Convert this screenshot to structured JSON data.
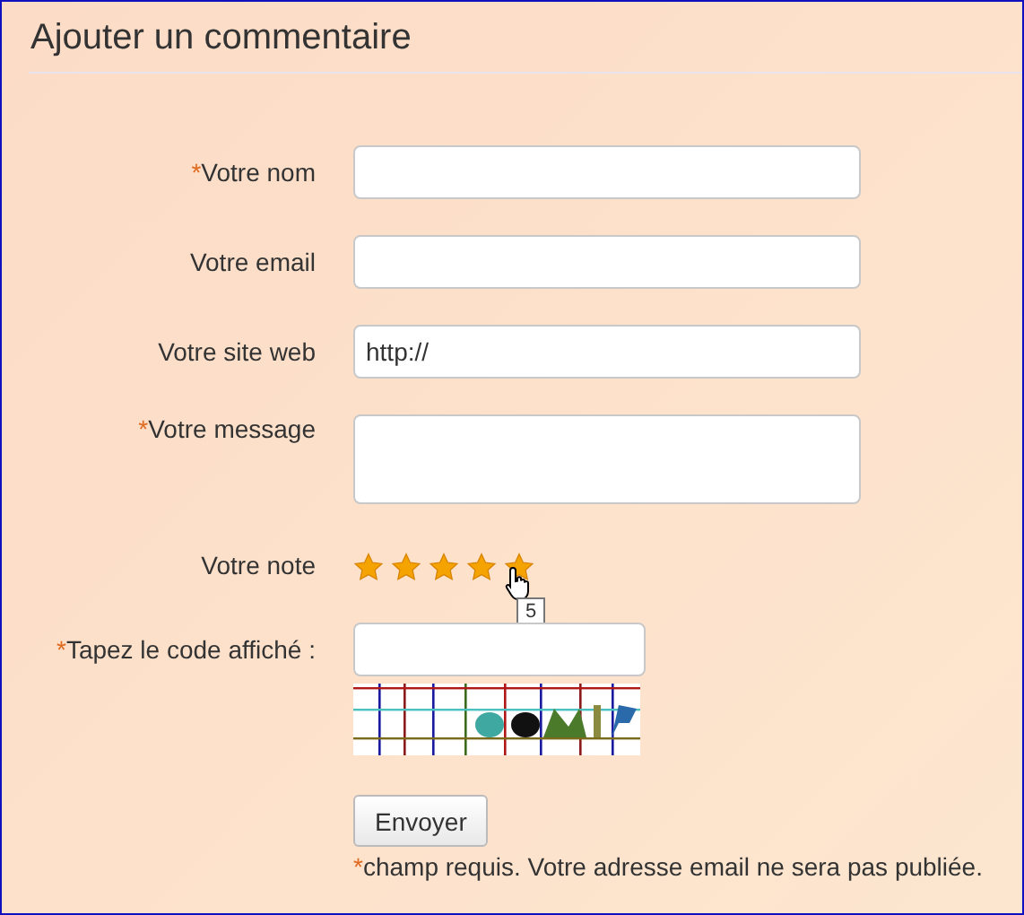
{
  "title": "Ajouter un commentaire",
  "fields": [
    {
      "kind": "input",
      "required_mark": "*",
      "label": "Votre nom"
    },
    {
      "kind": "input",
      "label": "Votre email"
    },
    {
      "kind": "input",
      "label": "Votre site web",
      "value": "http://"
    },
    {
      "kind": "textarea",
      "required_mark": "*",
      "label": "Votre message"
    },
    {
      "kind": "rating",
      "label": "Votre note",
      "stars": 5,
      "tooltip": "5"
    },
    {
      "kind": "captcha",
      "required_mark": "*",
      "label": "Tapez le code affiché :"
    }
  ],
  "submit": "Envoyer",
  "footnote": {
    "mark": "*",
    "text": "champ requis. Votre adresse email ne sera pas publiée."
  }
}
